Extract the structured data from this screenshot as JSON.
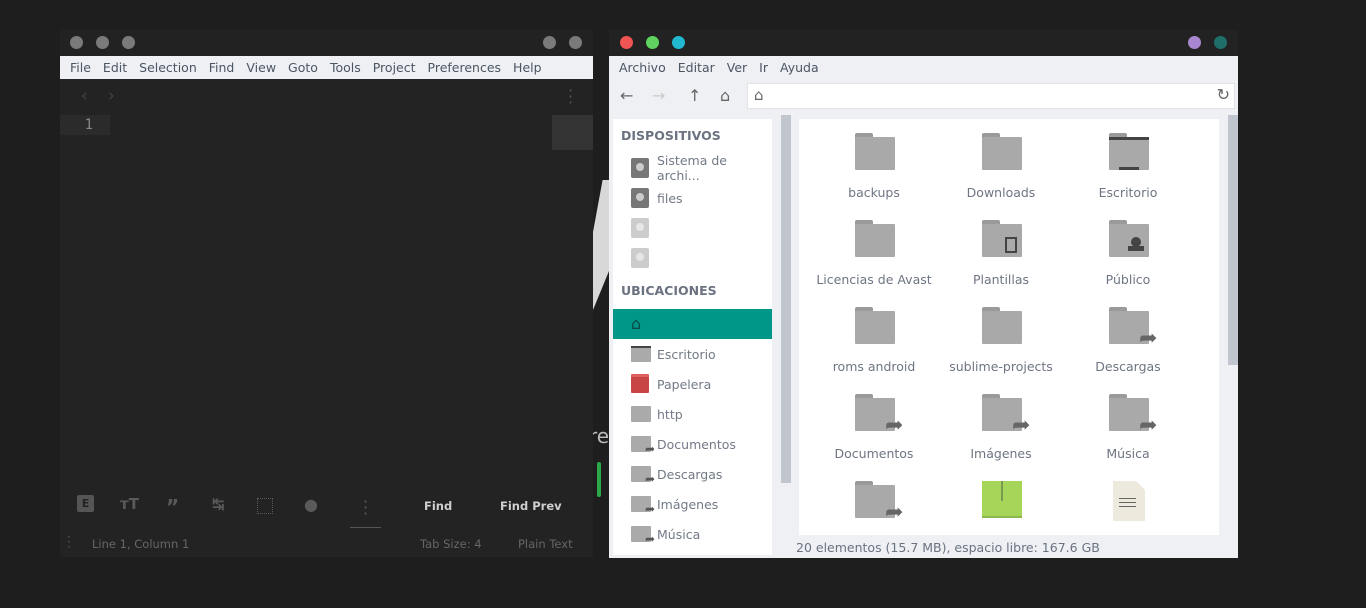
{
  "editor": {
    "menu": [
      "File",
      "Edit",
      "Selection",
      "Find",
      "View",
      "Goto",
      "Tools",
      "Project",
      "Preferences",
      "Help"
    ],
    "line_number": "1",
    "toolbar": {
      "find": "Find",
      "find_prev": "Find Prev"
    },
    "status": {
      "position": "Line 1, Column 1",
      "tab_size": "Tab Size: 4",
      "syntax": "Plain Text"
    },
    "title_dots": [
      "#7a7a7a",
      "#7a7a7a",
      "#7a7a7a",
      "#7a7a7a",
      "#7a7a7a"
    ]
  },
  "wallpaper": {
    "fragment": "re"
  },
  "files": {
    "title_dots": [
      "#f05454",
      "#5ed35e",
      "#22b8d0",
      "#a987d0",
      "#1e6f6a"
    ],
    "menu": [
      "Archivo",
      "Editar",
      "Ver",
      "Ir",
      "Ayuda"
    ],
    "sidebar": {
      "devices_header": "DISPOSITIVOS",
      "devices": [
        "Sistema de archi...",
        "files",
        "",
        ""
      ],
      "places_header": "UBICACIONES",
      "places": [
        "",
        "Escritorio",
        "Papelera",
        "http",
        "Documentos",
        "Descargas",
        "Imágenes",
        "Música"
      ]
    },
    "items": [
      {
        "name": "backups",
        "icon": "folder"
      },
      {
        "name": "Downloads",
        "icon": "folder"
      },
      {
        "name": "Escritorio",
        "icon": "desktop"
      },
      {
        "name": "Licencias de Avast",
        "icon": "folder"
      },
      {
        "name": "Plantillas",
        "icon": "templates"
      },
      {
        "name": "Público",
        "icon": "public"
      },
      {
        "name": "roms android",
        "icon": "folder"
      },
      {
        "name": "sublime-projects",
        "icon": "folder"
      },
      {
        "name": "Descargas",
        "icon": "folder-link"
      },
      {
        "name": "Documentos",
        "icon": "folder-link"
      },
      {
        "name": "Imágenes",
        "icon": "folder-link"
      },
      {
        "name": "Música",
        "icon": "folder-link"
      },
      {
        "name": "",
        "icon": "folder-link"
      },
      {
        "name": "",
        "icon": "archive"
      },
      {
        "name": "",
        "icon": "text-file"
      }
    ],
    "status": "20 elementos (15.7 MB), espacio libre: 167.6 GB",
    "accent": "#009688"
  }
}
